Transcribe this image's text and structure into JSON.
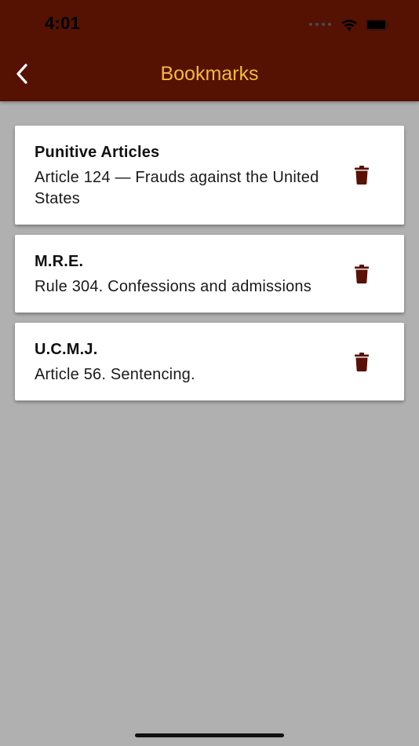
{
  "status_bar": {
    "time": "4:01"
  },
  "nav": {
    "title": "Bookmarks",
    "back_icon": "chevron-left-icon"
  },
  "bookmarks": [
    {
      "category": "Punitive Articles",
      "title": "Article 124 — Frauds against the United States",
      "action_icon": "trash-icon"
    },
    {
      "category": "M.R.E.",
      "title": "Rule 304. Confessions and admissions",
      "action_icon": "trash-icon"
    },
    {
      "category": "U.C.M.J.",
      "title": "Article 56. Sentencing.",
      "action_icon": "trash-icon"
    }
  ],
  "colors": {
    "brand": "#551202",
    "title_accent": "#f5b93a",
    "trash": "#5a1206",
    "background": "#b0b0b0"
  }
}
